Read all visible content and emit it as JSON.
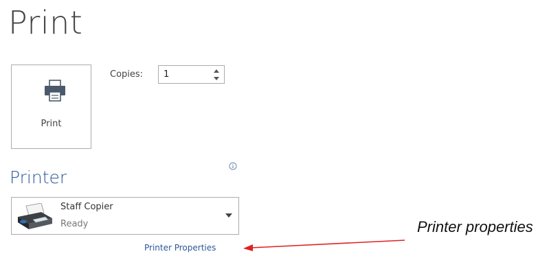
{
  "page": {
    "title": "Print"
  },
  "print_button": {
    "label": "Print",
    "icon": "printer-icon"
  },
  "copies": {
    "label": "Copies:",
    "value": "1"
  },
  "printer": {
    "heading": "Printer",
    "info_icon": "info-icon",
    "selected": {
      "name": "Staff Copier",
      "status": "Ready",
      "icon": "printer-device-icon"
    },
    "properties_link": "Printer Properties"
  },
  "annotation": {
    "text": "Printer properties",
    "arrow_color": "#e02020"
  },
  "colors": {
    "accent": "#2b579a",
    "border": "#ababab",
    "text": "#444444"
  }
}
